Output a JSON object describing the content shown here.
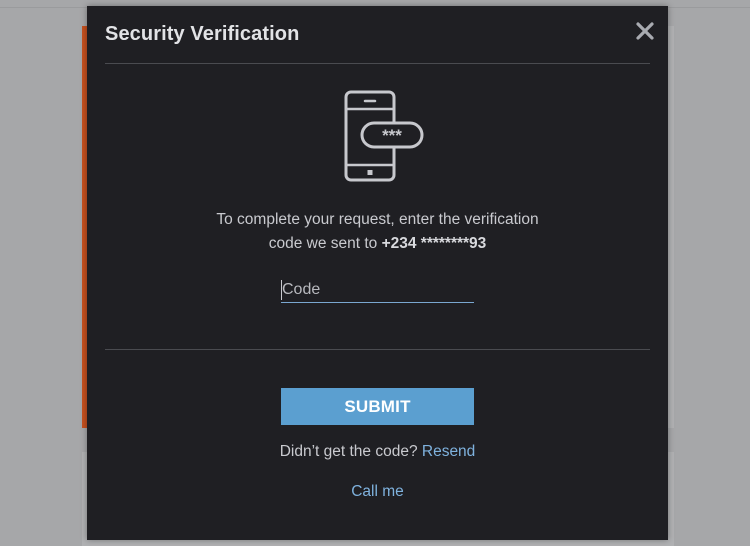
{
  "modal": {
    "title": "Security Verification",
    "close_icon": "close-icon",
    "illustration_icon": "phone-password-icon",
    "illustration_mask": "***",
    "message_line1": "To complete your request, enter the verification",
    "message_line2_prefix": "code we sent to ",
    "phone_number": "+234 ********93",
    "code_input": {
      "value": "",
      "placeholder": "Code"
    },
    "submit_label": "SUBMIT",
    "resend_prompt": "Didn’t get the code?",
    "resend_label": "Resend",
    "call_me_label": "Call me"
  },
  "colors": {
    "modal_background": "#1f1f23",
    "accent_blue": "#5b9fd0",
    "link_blue": "#7fb2de",
    "overlay": "#a6a7a9",
    "background_accent": "#c4501f"
  }
}
